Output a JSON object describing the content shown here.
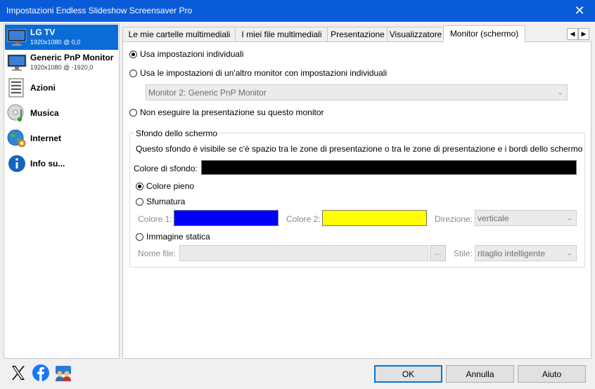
{
  "window": {
    "title": "Impostazioni Endless Slideshow Screensaver Pro"
  },
  "sidebar": {
    "items": [
      {
        "label": "LG TV",
        "sub": "1920x1080 @ 0,0"
      },
      {
        "label": "Generic PnP Monitor",
        "sub": "1920x1080 @ -1920,0"
      },
      {
        "label": "Azioni"
      },
      {
        "label": "Musica"
      },
      {
        "label": "Internet"
      },
      {
        "label": "Info su..."
      }
    ]
  },
  "tabs": [
    {
      "label": "Le mie cartelle multimediali"
    },
    {
      "label": "I miei file multimediali"
    },
    {
      "label": "Presentazione"
    },
    {
      "label": "Visualizzatore"
    },
    {
      "label": "Monitor (schermo)"
    }
  ],
  "tab_scroll": {
    "left": "◀",
    "right": "▶"
  },
  "monitor": {
    "opt_individual": "Usa impostazioni individuali",
    "opt_other": "Usa le impostazioni di un'altro monitor con impostazioni individuali",
    "other_monitor_value": "Monitor 2: Generic PnP Monitor",
    "opt_none": "Non eseguire la presentazione su questo monitor"
  },
  "background": {
    "group_title": "Sfondo dello schermo",
    "description": "Questo sfondo è visibile se c'è spazio tra le zone di presentazione o tra le zone di presentazione e i bordi dello schermo",
    "color_label": "Colore di sfondo:",
    "color_value": "#000000",
    "opt_solid": "Colore pieno",
    "opt_gradient": "Sfumatura",
    "color1_label": "Colore 1:",
    "color1_value": "#0000ff",
    "color2_label": "Colore 2:",
    "color2_value": "#ffff00",
    "direction_label": "Direzione:",
    "direction_value": "verticale",
    "opt_image": "Immagine statica",
    "file_label": "Nome file:",
    "browse_label": "...",
    "style_label": "Stile:",
    "style_value": "ritaglio intelligente"
  },
  "footer": {
    "ok": "OK",
    "cancel": "Annulla",
    "help": "Aiuto",
    "social": [
      "x-icon",
      "facebook-icon",
      "community-icon"
    ]
  }
}
